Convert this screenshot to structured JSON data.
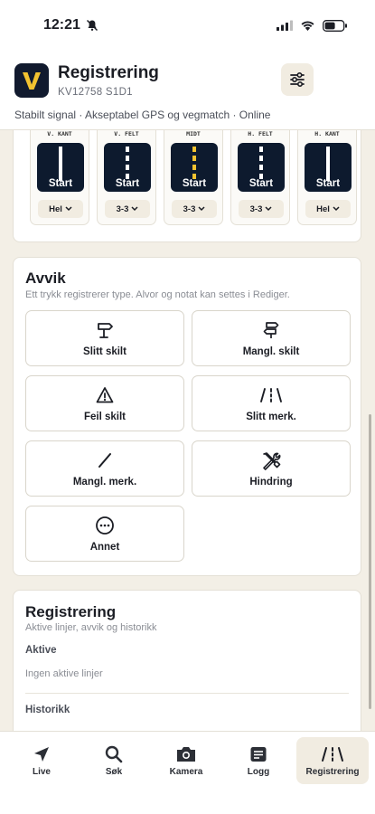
{
  "status_bar": {
    "time": "12:21"
  },
  "header": {
    "logo_letter": "V",
    "title": "Registrering",
    "subtitle": "KV12758 S1D1",
    "status_line": "Stabilt signal · Akseptabel GPS og vegmatch · Online"
  },
  "lines": [
    {
      "title": "V. KANT",
      "start_label": "Start",
      "selected": "Hel",
      "line_style": "solid"
    },
    {
      "title": "V. FELT",
      "start_label": "Start",
      "selected": "3-3",
      "line_style": "dashed"
    },
    {
      "title": "MIDT",
      "start_label": "Start",
      "selected": "3-3",
      "line_style": "yellow"
    },
    {
      "title": "H. FELT",
      "start_label": "Start",
      "selected": "3-3",
      "line_style": "dashed"
    },
    {
      "title": "H. KANT",
      "start_label": "Start",
      "selected": "Hel",
      "line_style": "solid"
    }
  ],
  "avvik": {
    "title": "Avvik",
    "description": "Ett trykk registrerer type. Alvor og notat kan settes i Rediger.",
    "buttons": [
      {
        "label": "Slitt skilt",
        "icon": "signpost-icon"
      },
      {
        "label": "Mangl. skilt",
        "icon": "signpost-missing-icon"
      },
      {
        "label": "Feil skilt",
        "icon": "warning-triangle-icon"
      },
      {
        "label": "Slitt merk.",
        "icon": "road-marking-icon"
      },
      {
        "label": "Mangl. merk.",
        "icon": "slash-icon"
      },
      {
        "label": "Hindring",
        "icon": "tools-icon"
      },
      {
        "label": "Annet",
        "icon": "more-icon"
      }
    ]
  },
  "registrering": {
    "title": "Registrering",
    "description": "Aktive linjer, avvik og historikk",
    "active_label": "Aktive",
    "active_empty": "Ingen aktive linjer",
    "history_label": "Historikk"
  },
  "nav": {
    "items": [
      {
        "label": "Live",
        "icon": "location-arrow-icon",
        "active": false
      },
      {
        "label": "Søk",
        "icon": "search-icon",
        "active": false
      },
      {
        "label": "Kamera",
        "icon": "camera-icon",
        "active": false
      },
      {
        "label": "Logg",
        "icon": "log-icon",
        "active": false
      },
      {
        "label": "Registrering",
        "icon": "road-marking-icon",
        "active": true
      }
    ]
  }
}
